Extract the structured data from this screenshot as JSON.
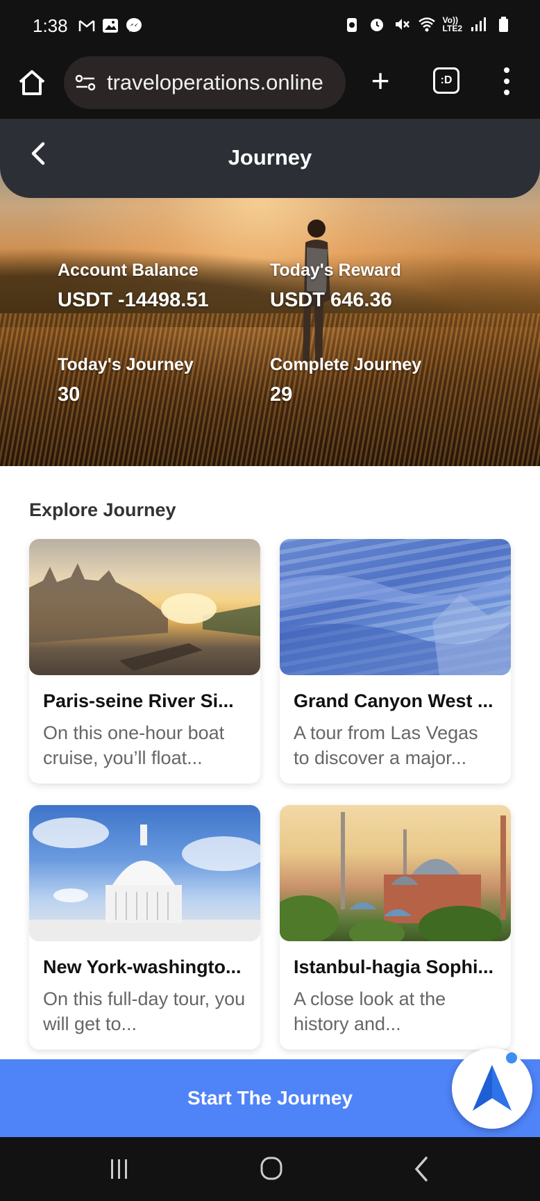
{
  "status_bar": {
    "time": "1:38",
    "network_label_top": "Vo))",
    "network_label_bottom": "LTE2"
  },
  "browser": {
    "url": "traveloperations.online",
    "tabs_label": ":D"
  },
  "header": {
    "title": "Journey"
  },
  "stats": {
    "account_balance_label": "Account Balance",
    "account_balance_value": "USDT -14498.51",
    "todays_reward_label": "Today's Reward",
    "todays_reward_value": "USDT 646.36",
    "todays_journey_label": "Today's Journey",
    "todays_journey_value": "30",
    "complete_journey_label": "Complete Journey",
    "complete_journey_value": "29"
  },
  "explore": {
    "title": "Explore Journey",
    "cards": [
      {
        "title": "Paris-seine River Si...",
        "description": "On this one-hour boat cruise, you’ll float..."
      },
      {
        "title": "Grand Canyon West ...",
        "description": "A tour from Las Vegas to discover a major..."
      },
      {
        "title": "New York-washingto...",
        "description": "On this full-day tour, you will get to..."
      },
      {
        "title": "Istanbul-hagia Sophi...",
        "description": "A close look at the history and..."
      }
    ]
  },
  "actions": {
    "start_label": "Start The Journey"
  },
  "colors": {
    "accent": "#4f83f8",
    "header_bg": "#2c2f35",
    "fab_arrow": "#2f73e8"
  }
}
